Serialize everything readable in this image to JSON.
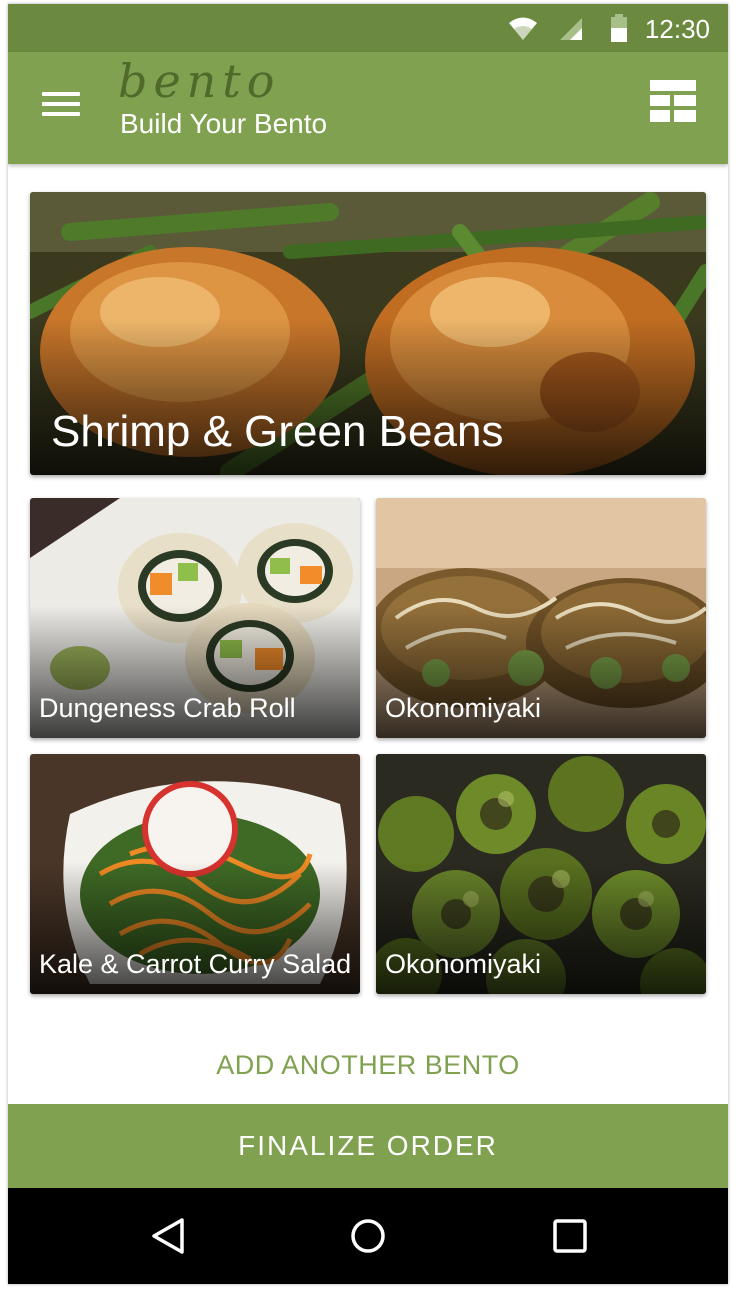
{
  "status_bar": {
    "time": "12:30",
    "icons": [
      "wifi-icon",
      "signal-icon",
      "battery-icon"
    ]
  },
  "app_bar": {
    "logo": "bento",
    "title": "Build Your Bento",
    "menu_icon": "hamburger-menu-icon",
    "action_icon": "bento-grid-icon"
  },
  "main_dish": {
    "name": "Shrimp & Green Beans"
  },
  "side_dishes": [
    {
      "name": "Dungeness Crab Roll"
    },
    {
      "name": "Okonomiyaki"
    },
    {
      "name": "Kale & Carrot Curry Salad"
    },
    {
      "name": "Okonomiyaki"
    }
  ],
  "add_another_label": "ADD ANOTHER BENTO",
  "finalize_label": "FINALIZE ORDER",
  "nav_bar": {
    "icons": [
      "back-icon",
      "home-icon",
      "recents-icon"
    ]
  },
  "colors": {
    "status_bar": "#6b8a3f",
    "app_bar": "#7fa150",
    "accent": "#7fa150",
    "logo": "#4f6a2a",
    "nav_bar": "#000000"
  }
}
